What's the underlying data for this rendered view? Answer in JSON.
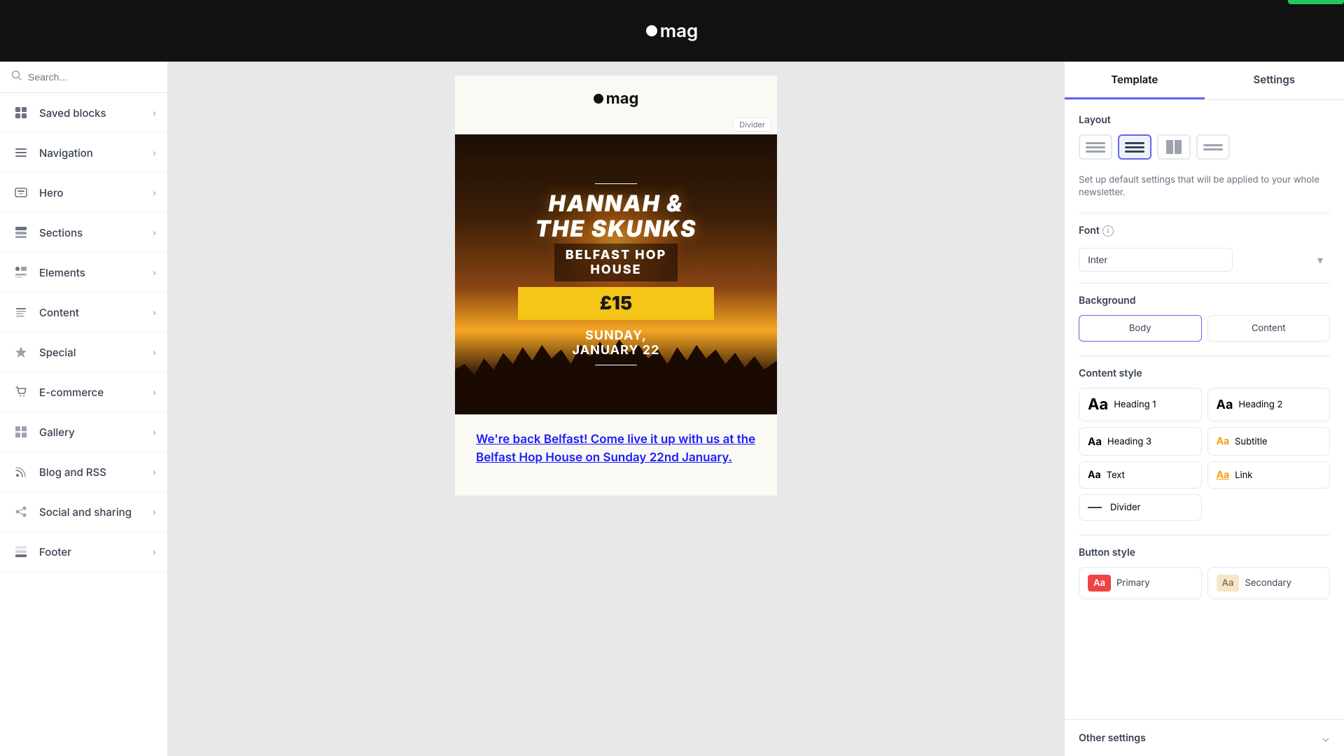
{
  "topbar": {
    "logo": "mag",
    "logo_dot_char": "●"
  },
  "sidebar": {
    "search_placeholder": "Search...",
    "items": [
      {
        "id": "saved-blocks",
        "label": "Saved blocks",
        "icon": "grid"
      },
      {
        "id": "navigation",
        "label": "Navigation",
        "icon": "nav"
      },
      {
        "id": "hero",
        "label": "Hero",
        "icon": "hero"
      },
      {
        "id": "sections",
        "label": "Sections",
        "icon": "sections"
      },
      {
        "id": "elements",
        "label": "Elements",
        "icon": "elements"
      },
      {
        "id": "content",
        "label": "Content",
        "icon": "content"
      },
      {
        "id": "special",
        "label": "Special",
        "icon": "special"
      },
      {
        "id": "ecommerce",
        "label": "E-commerce",
        "icon": "ecommerce"
      },
      {
        "id": "gallery",
        "label": "Gallery",
        "icon": "gallery"
      },
      {
        "id": "blog-rss",
        "label": "Blog and RSS",
        "icon": "blog"
      },
      {
        "id": "social",
        "label": "Social and sharing",
        "icon": "social"
      },
      {
        "id": "footer",
        "label": "Footer",
        "icon": "footer"
      }
    ]
  },
  "canvas": {
    "logo": "mag",
    "divider_label": "Divider",
    "concert": {
      "band_name_line1": "HANNAH &",
      "band_name_line2": "THE SKUNKS",
      "venue_line1": "BELFAST HOP",
      "venue_line2": "HOUSE",
      "price": "£15",
      "date_line1": "SUNDAY,",
      "date_line2": "JANUARY 22"
    },
    "body_text": "We're back Belfast! Come live it up with us at the Belfast Hop House on Sunday 22nd January."
  },
  "right_panel": {
    "tab_template": "Template",
    "tab_settings": "Settings",
    "active_tab": "Template",
    "layout_label": "Layout",
    "setup_text": "Set up default settings that will be applied to your whole newsletter.",
    "font_label": "Font",
    "font_info": "i",
    "font_selected": "Inter",
    "font_dropdown_arrow": "▾",
    "background_label": "Background",
    "bg_body": "Body",
    "bg_content": "Content",
    "content_style_label": "Content style",
    "content_styles": [
      {
        "id": "heading1",
        "preview": "Aa",
        "label": "Heading 1",
        "size": "large"
      },
      {
        "id": "heading2",
        "preview": "Aa",
        "label": "Heading 2",
        "size": "medium"
      },
      {
        "id": "heading3",
        "preview": "Aa",
        "label": "Heading 3",
        "size": "small"
      },
      {
        "id": "subtitle",
        "preview": "Aa",
        "label": "Subtitle",
        "size": "small",
        "color": "orange"
      },
      {
        "id": "text",
        "preview": "Aa",
        "label": "Text",
        "size": "small"
      },
      {
        "id": "link",
        "preview": "Aa",
        "label": "Link",
        "size": "small",
        "color": "orange"
      },
      {
        "id": "divider",
        "preview": "—",
        "label": "Divider",
        "size": "small"
      }
    ],
    "button_style_label": "Button style",
    "button_styles": [
      {
        "id": "primary",
        "preview": "Aa",
        "label": "Primary",
        "type": "primary"
      },
      {
        "id": "secondary",
        "preview": "Aa",
        "label": "Secondary",
        "type": "secondary"
      }
    ],
    "other_settings_label": "Other settings"
  }
}
